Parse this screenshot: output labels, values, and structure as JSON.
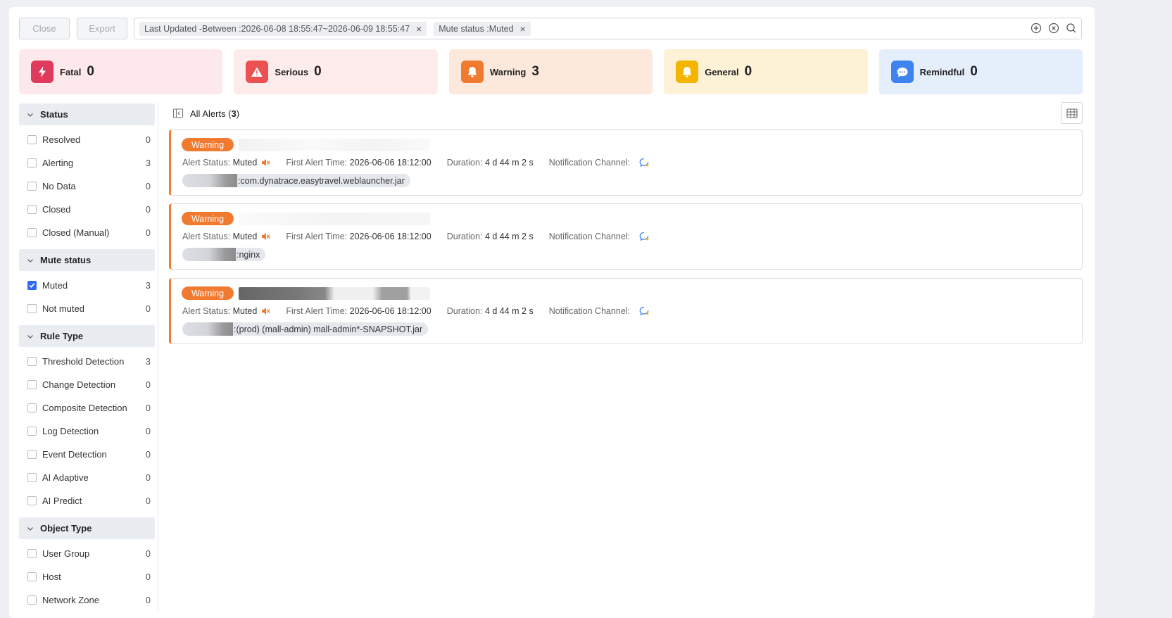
{
  "toolbar": {
    "close_label": "Close",
    "export_label": "Export",
    "filters": [
      {
        "label": "Last Updated -Between :2026-06-08 18:55:47~2026-06-09 18:55:47"
      },
      {
        "label": "Mute status  :Muted"
      }
    ],
    "chip_close": "×",
    "icons": [
      "add-circle-icon",
      "clear-circle-icon",
      "search-icon"
    ]
  },
  "severity": [
    {
      "label": "Fatal",
      "count": "0",
      "icon": "lightning-icon",
      "bg": "#fde9ec",
      "icon_bg": "#e03a5d"
    },
    {
      "label": "Serious",
      "count": "0",
      "icon": "warning-triangle-icon",
      "bg": "#fdeceb",
      "icon_bg": "#ec5151"
    },
    {
      "label": "Warning",
      "count": "3",
      "icon": "bell-icon",
      "bg": "#fde9dc",
      "icon_bg": "#f07a2f"
    },
    {
      "label": "General",
      "count": "0",
      "icon": "bell-icon",
      "bg": "#fdf1d6",
      "icon_bg": "#f5b400"
    },
    {
      "label": "Remindful",
      "count": "0",
      "icon": "chat-bubble-icon",
      "bg": "#e5eefb",
      "icon_bg": "#3e83f0"
    }
  ],
  "facets": {
    "status": {
      "title": "Status",
      "items": [
        {
          "label": "Resolved",
          "count": "0",
          "checked": false
        },
        {
          "label": "Alerting",
          "count": "3",
          "checked": false
        },
        {
          "label": "No Data",
          "count": "0",
          "checked": false
        },
        {
          "label": "Closed",
          "count": "0",
          "checked": false
        },
        {
          "label": "Closed (Manual)",
          "count": "0",
          "checked": false
        }
      ]
    },
    "mute": {
      "title": "Mute status",
      "items": [
        {
          "label": "Muted",
          "count": "3",
          "checked": true
        },
        {
          "label": "Not muted",
          "count": "0",
          "checked": false
        }
      ]
    },
    "rule_type": {
      "title": "Rule Type",
      "items": [
        {
          "label": "Threshold Detection",
          "count": "3",
          "checked": false
        },
        {
          "label": "Change Detection",
          "count": "0",
          "checked": false
        },
        {
          "label": "Composite Detection",
          "count": "0",
          "checked": false
        },
        {
          "label": "Log Detection",
          "count": "0",
          "checked": false
        },
        {
          "label": "Event Detection",
          "count": "0",
          "checked": false
        },
        {
          "label": "AI Adaptive",
          "count": "0",
          "checked": false
        },
        {
          "label": "AI Predict",
          "count": "0",
          "checked": false
        }
      ]
    },
    "object_type": {
      "title": "Object Type",
      "items": [
        {
          "label": "User Group",
          "count": "0",
          "checked": false
        },
        {
          "label": "Host",
          "count": "0",
          "checked": false
        },
        {
          "label": "Network Zone",
          "count": "0",
          "checked": false
        }
      ]
    }
  },
  "main": {
    "title_prefix": "All Alerts (",
    "title_count": "3",
    "title_suffix": ")",
    "alerts": [
      {
        "severity": "Warning",
        "status_label": "Alert Status:",
        "status": "Muted",
        "first_label": "First Alert Time:",
        "first_time": "2026-06-06 18:12:00",
        "duration_label": "Duration:",
        "duration": "4 d 44 m 2 s",
        "channel_label": "Notification Channel:",
        "object": ":com.dynatrace.easytravel.weblauncher.jar"
      },
      {
        "severity": "Warning",
        "status_label": "Alert Status:",
        "status": "Muted",
        "first_label": "First Alert Time:",
        "first_time": "2026-06-06 18:12:00",
        "duration_label": "Duration:",
        "duration": "4 d 44 m 2 s",
        "channel_label": "Notification Channel:",
        "object": ":nginx"
      },
      {
        "severity": "Warning",
        "status_label": "Alert Status:",
        "status": "Muted",
        "first_label": "First Alert Time:",
        "first_time": "2026-06-06 18:12:00",
        "duration_label": "Duration:",
        "duration": "4 d 44 m 2 s",
        "channel_label": "Notification Channel:",
        "object": ":(prod) (mall-admin) mall-admin*-SNAPSHOT.jar"
      }
    ]
  }
}
